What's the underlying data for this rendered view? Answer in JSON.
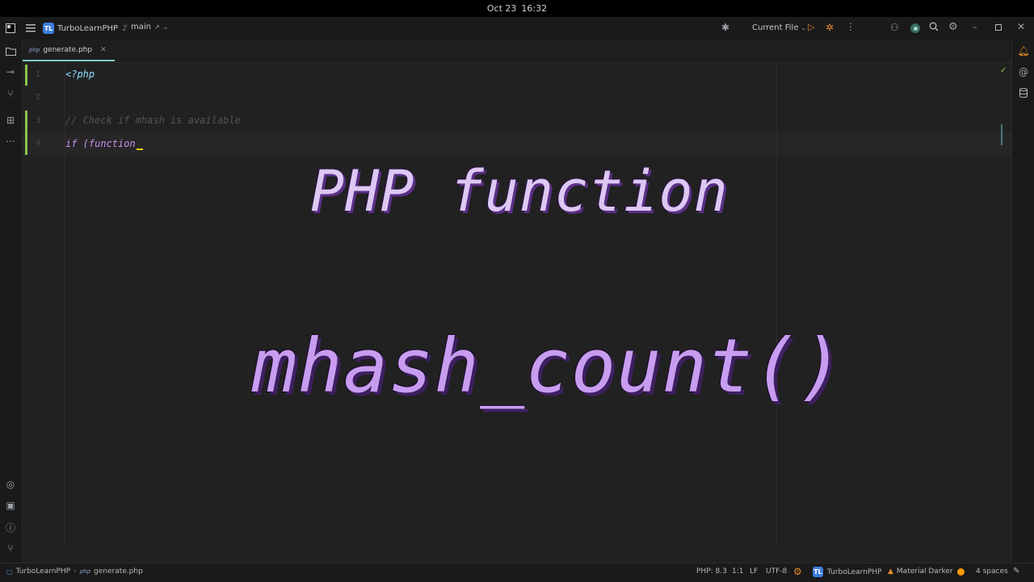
{
  "system": {
    "date": "Oct 23",
    "time": "16:32"
  },
  "titlebar": {
    "project_badge": "TL",
    "project_name": "TurboLearnPHP",
    "branch": "main",
    "run_config": "Current File"
  },
  "tab": {
    "file_type": "php",
    "file_name": "generate.php"
  },
  "editor": {
    "lines": [
      {
        "number": "1",
        "text": "<?php"
      },
      {
        "number": "2",
        "text": ""
      },
      {
        "number": "3",
        "text": "// Check if mhash is available"
      },
      {
        "number": "4",
        "text": "if (function_"
      }
    ]
  },
  "overlay": {
    "line1": "PHP function",
    "line2": "mhash_count()"
  },
  "statusbar": {
    "breadcrumb_project": "TurboLearnPHP",
    "breadcrumb_file": "generate.php",
    "php_version": "PHP: 8.3",
    "position": "1:1",
    "line_ending": "LF",
    "encoding": "UTF-8",
    "project_badge": "TL",
    "project_name": "TurboLearnPHP",
    "theme": "Material Darker",
    "indent": "4 spaces"
  },
  "colors": {
    "accent": "#80cbc4",
    "keyword": "#c792ea",
    "comment": "#545454",
    "tag": "#89ddff",
    "change_marker": "#8bc34a",
    "status_dot": "#ff9800"
  }
}
